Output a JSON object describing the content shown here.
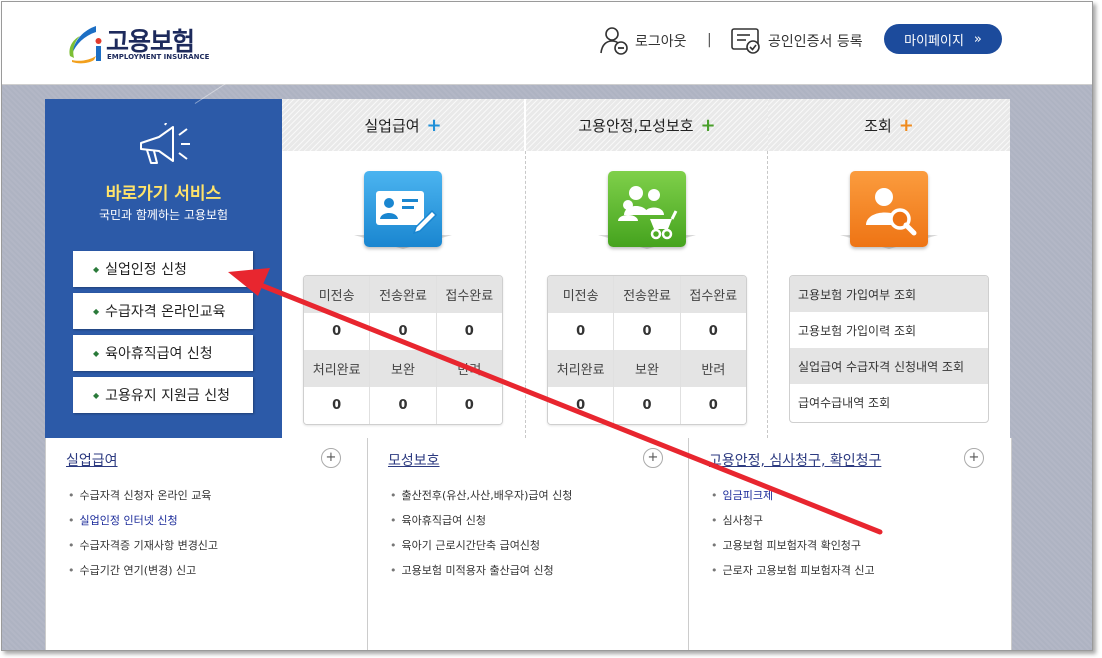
{
  "header": {
    "logo_title": "고용보험",
    "logo_subtitle": "EMPLOYMENT INSURANCE",
    "logout_label": "로그아웃",
    "divider": "|",
    "cert_label": "공인인증서 등록",
    "mypage_label": "마이페이지",
    "mypage_chevron": "»"
  },
  "quick": {
    "title": "바로가기 서비스",
    "subtitle": "국민과 함께하는 고용보험",
    "buttons": [
      "실업인정 신청",
      "수급자격 온라인교육",
      "육아휴직급여 신청",
      "고용유지 지원금 신청"
    ]
  },
  "columns": [
    {
      "title": "실업급여",
      "plus": "+",
      "plus_color": "#1f8fd8",
      "stats": {
        "row1_labels": [
          "미전송",
          "전송완료",
          "접수완료"
        ],
        "row1_values": [
          "0",
          "0",
          "0"
        ],
        "row2_labels": [
          "처리완료",
          "보완",
          "반려"
        ],
        "row2_values": [
          "0",
          "0",
          "0"
        ]
      }
    },
    {
      "title": "고용안정,모성보호",
      "plus": "+",
      "plus_color": "#4aa02c",
      "stats": {
        "row1_labels": [
          "미전송",
          "전송완료",
          "접수완료"
        ],
        "row1_values": [
          "0",
          "0",
          "0"
        ],
        "row2_labels": [
          "처리완료",
          "보완",
          "반려"
        ],
        "row2_values": [
          "0",
          "0",
          "0"
        ]
      }
    },
    {
      "title": "조회",
      "plus": "+",
      "plus_color": "#f08a1c",
      "lookups": [
        "고용보험 가입여부 조회",
        "고용보험 가입이력 조회",
        "실업급여 수급자격 신청내역 조회",
        "급여수급내역 조회"
      ]
    }
  ],
  "bottom": [
    {
      "title": "실업급여",
      "plus": "+",
      "items": [
        "수급자격 신청자 온라인 교육",
        "실업인정 인터넷 신청",
        "수급자격증 기재사항 변경신고",
        "수급기간 연기(변경) 신고"
      ]
    },
    {
      "title": "모성보호",
      "plus": "+",
      "items": [
        "출산전후(유산,사산,배우자)급여 신청",
        "육아휴직급여 신청",
        "육아기 근로시간단축 급여신청",
        "고용보험 미적용자 출산급여 신청"
      ]
    },
    {
      "title": "고용안정, 심사청구, 확인청구",
      "plus": "+",
      "items": [
        "임금피크제",
        "심사청구",
        "고용보험 피보험자격 확인청구",
        "근로자 고용보험 피보험자격 신고"
      ]
    }
  ],
  "colors": {
    "brand_blue": "#2c5aa8",
    "mypage_button": "#1c4b9c",
    "annotation_arrow": "#e8262f",
    "tile_blue": "#2a9be0",
    "tile_green": "#5dbb2f",
    "tile_orange": "#f7841e"
  },
  "icons": [
    "logo-mark-icon",
    "logout-user-icon",
    "certificate-icon",
    "megaphone-icon",
    "application-form-icon",
    "family-icon",
    "search-person-icon",
    "annotation-arrow"
  ]
}
